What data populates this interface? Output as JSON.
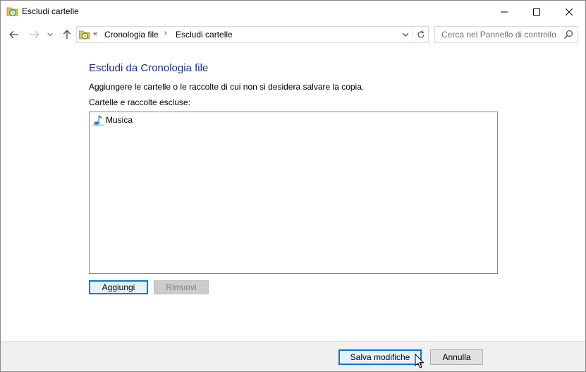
{
  "window": {
    "title": "Escludi cartelle",
    "icon": "file-history-icon",
    "controls": {
      "minimize": "minimize-icon",
      "maximize": "maximize-icon",
      "close": "close-icon"
    }
  },
  "navigation": {
    "back_icon": "arrow-left-icon",
    "forward_icon": "arrow-right-icon",
    "recent_icon": "chevron-down-icon",
    "up_icon": "arrow-up-icon",
    "address": {
      "overflow": "«",
      "breadcrumbs": [
        "Cronologia file",
        "Escludi cartelle"
      ],
      "separator": "›"
    },
    "search": {
      "placeholder": "Cerca nel Pannello di controllo"
    }
  },
  "content": {
    "heading": "Escludi da Cronologia file",
    "description": "Aggiungere le cartelle o le raccolte di cui non si desidera salvare la copia.",
    "list_label": "Cartelle e raccolte escluse:",
    "items": [
      {
        "label": "Musica",
        "icon": "music-note-icon"
      }
    ],
    "add_button": "Aggiungi",
    "remove_button": "Rimuovi"
  },
  "footer": {
    "save_button": "Salva modifiche",
    "cancel_button": "Annulla"
  },
  "colors": {
    "heading": "#1e3287",
    "accent": "#0078d7",
    "footer_bg": "#f0f0f0"
  }
}
